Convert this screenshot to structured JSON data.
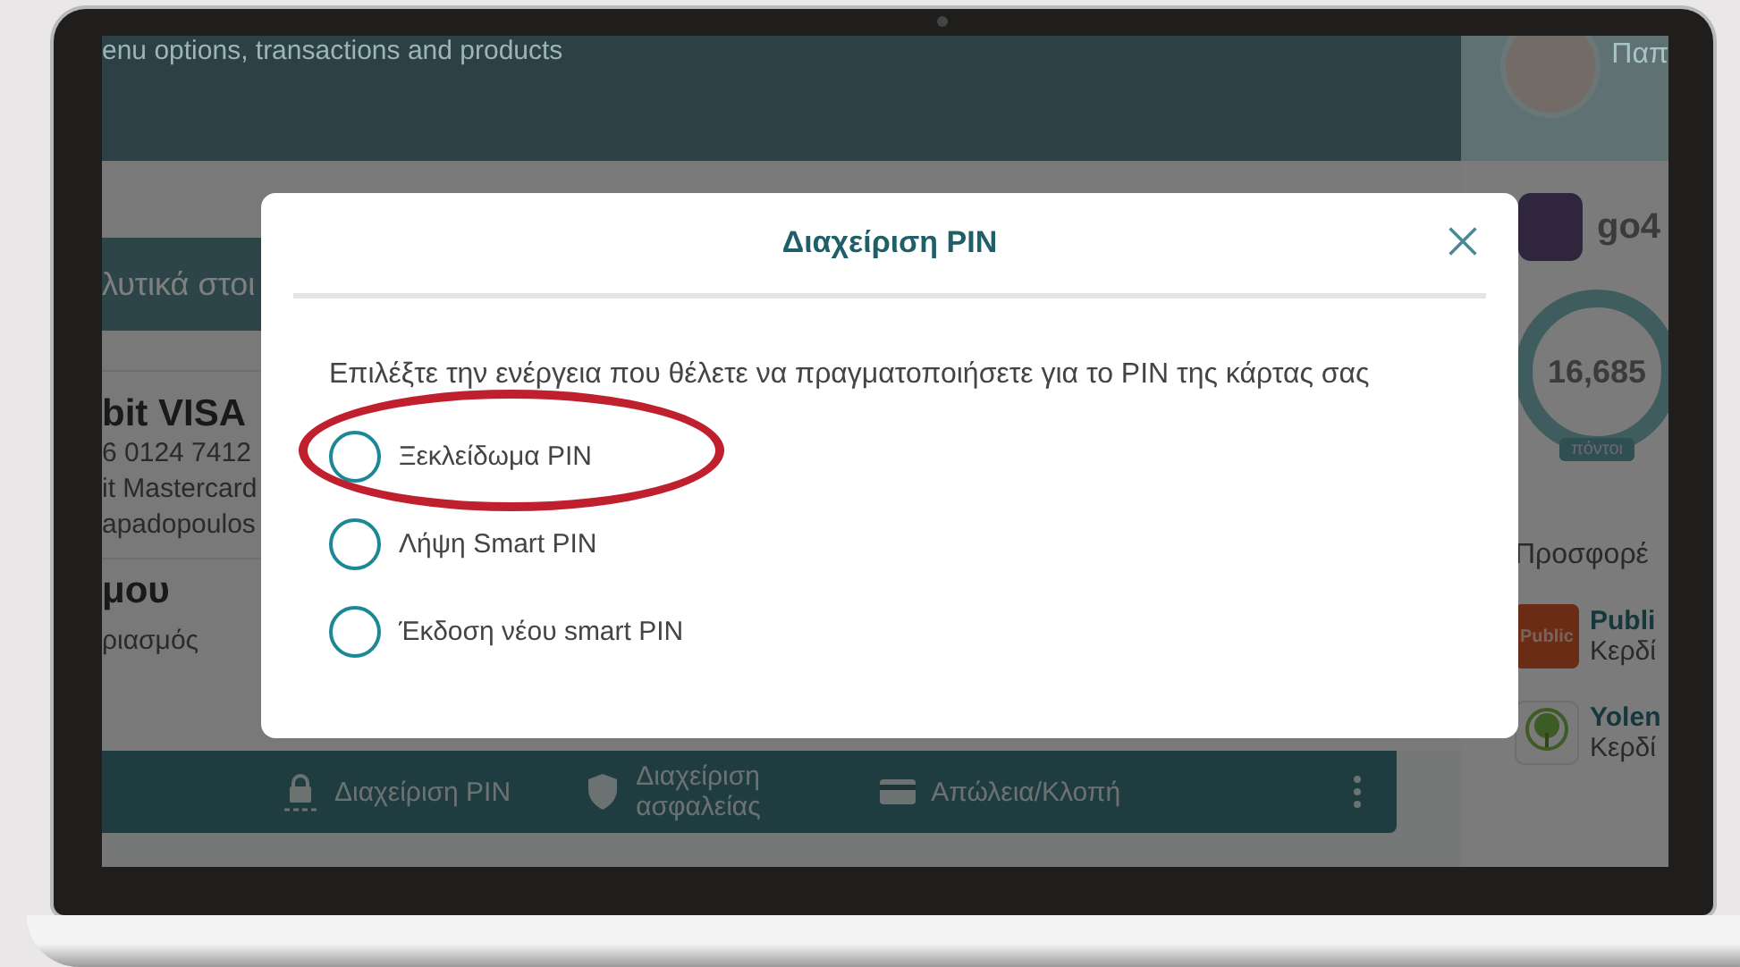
{
  "header": {
    "subtitle": "enu options, transactions and products"
  },
  "section_bar": {
    "title": "λυτικά στοι"
  },
  "card": {
    "name": "bit VISA",
    "number": "6 0124 7412",
    "type": "it Mastercard",
    "holder": "apadopoulos"
  },
  "account": {
    "title": "μου",
    "subtitle": "ριασμός"
  },
  "action_bar": [
    {
      "kind": "lock",
      "label": "Διαχείριση PIN"
    },
    {
      "kind": "shield",
      "label": "Διαχείριση ασφαλείας"
    },
    {
      "kind": "card",
      "label": "Απώλεια/Κλοπή"
    }
  ],
  "profile": {
    "name": "Παπ"
  },
  "loyalty": {
    "title": "go4",
    "points": "16,685",
    "unit": "πόντοι"
  },
  "offers": {
    "title": "Προσφορέ",
    "items": [
      {
        "kind": "public",
        "logo": "Public",
        "name": "Publi",
        "text": "Κερδί"
      },
      {
        "kind": "tree",
        "name": "Yolen",
        "text": "Κερδί"
      }
    ]
  },
  "modal": {
    "title": "Διαχείριση PIN",
    "prompt": "Επιλέξτε την ενέργεια που θέλετε να πραγματοποιήσετε για το PIN της κάρτας σας",
    "options": [
      {
        "label": "Ξεκλείδωμα PIN",
        "selected": false,
        "circled": true
      },
      {
        "label": "Λήψη Smart PIN",
        "selected": false,
        "circled": false
      },
      {
        "label": "Έκδοση νέου smart PIN",
        "selected": false,
        "circled": false
      }
    ]
  }
}
